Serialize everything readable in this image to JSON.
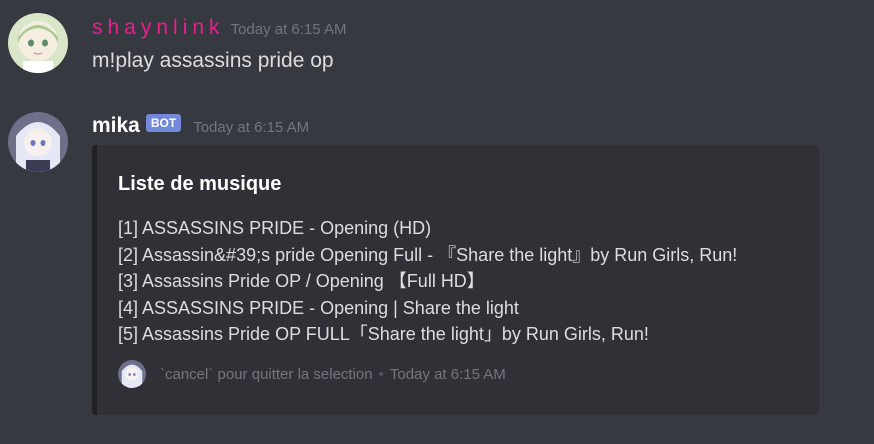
{
  "messages": [
    {
      "author": "shaynlink",
      "timestamp": "Today at 6:15 AM",
      "content": "m!play assassins pride op",
      "avatar_icon": "anime-girl-avatar"
    },
    {
      "author": "mika",
      "bot_tag": "BOT",
      "timestamp": "Today at 6:15 AM",
      "avatar_icon": "anime-bot-avatar",
      "embed": {
        "title": "Liste de musique",
        "items": [
          "[1] ASSASSINS PRIDE - Opening (HD)",
          "[2] Assassin&#39;s pride Opening Full - 『Share the light』by Run Girls, Run!",
          "[3] Assassins Pride OP / Opening 【Full HD】",
          "[4] ASSASSINS PRIDE - Opening | Share the light",
          "[5] Assassins Pride OP FULL「Share the light」by Run Girls, Run!"
        ],
        "footer_text": "`cancel` pour quitter la selection",
        "footer_separator": "•",
        "footer_timestamp": "Today at 6:15 AM"
      }
    }
  ],
  "colors": {
    "background": "#36393f",
    "embed_background": "#2f3136",
    "username_shaynlink": "#e91e8c",
    "bot_tag": "#7289da",
    "timestamp": "#72767d"
  }
}
